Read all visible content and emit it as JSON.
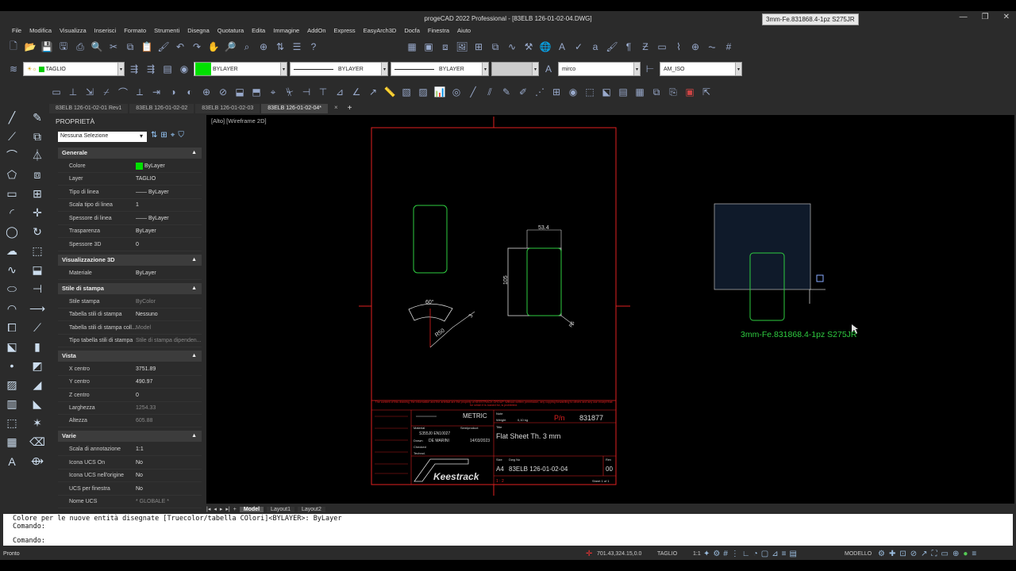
{
  "window": {
    "title": "progeCAD 2022 Professional - [83ELB 126-01-02-04.DWG]",
    "tooltip": "3mm-Fe.831868.4-1pz S275JR"
  },
  "menu": [
    "File",
    "Modifica",
    "Visualizza",
    "Inserisci",
    "Formato",
    "Strumenti",
    "Disegna",
    "Quotatura",
    "Edita",
    "Immagine",
    "AddOn",
    "Express",
    "EasyArch3D",
    "Docfa",
    "Finestra",
    "Aiuto"
  ],
  "toolbar": {
    "layer_combo": "TAGLIO",
    "color_combo": "BYLAYER",
    "linetype_combo": "BYLAYER",
    "lineweight_combo": "BYLAYER",
    "textstyle_combo": "mirco",
    "dimstyle_combo": "AM_ISO",
    "color_accent": "#00e000"
  },
  "doc_tabs": [
    "83ELB 126-01-02-01 Rev1",
    "83ELB 126-01-02-02",
    "83ELB 126-01-02-03",
    "83ELB 126-01-02-04*"
  ],
  "props": {
    "title": "PROPRIETÀ",
    "selection": "Nessuna Selezione",
    "generale": {
      "label": "Generale",
      "rows": [
        [
          "Colore",
          "ByLayer"
        ],
        [
          "Layer",
          "TAGLIO"
        ],
        [
          "Tipo di linea",
          "—— ByLayer"
        ],
        [
          "Scala tipo di linea",
          "1"
        ],
        [
          "Spessore di linea",
          "—— ByLayer"
        ],
        [
          "Trasparenza",
          "ByLayer"
        ],
        [
          "Spessore 3D",
          "0"
        ]
      ]
    },
    "vis3d": {
      "label": "Visualizzazione 3D",
      "rows": [
        [
          "Materiale",
          "ByLayer"
        ]
      ]
    },
    "stampa": {
      "label": "Stile di stampa",
      "rows": [
        [
          "Stile stampa",
          "ByColor"
        ],
        [
          "Tabella stili di stampa",
          "Nessuno"
        ],
        [
          "Tabella stili di stampa coll...",
          "Model"
        ],
        [
          "Tipo tabella stili di stampa",
          "Stile di stampa dipenden..."
        ]
      ]
    },
    "vista": {
      "label": "Vista",
      "rows": [
        [
          "X centro",
          "3751.89"
        ],
        [
          "Y centro",
          "490.97"
        ],
        [
          "Z centro",
          "0"
        ],
        [
          "Larghezza",
          "1254.33"
        ],
        [
          "Altezza",
          "605.88"
        ]
      ]
    },
    "varie": {
      "label": "Varie",
      "rows": [
        [
          "Scala di annotazione",
          "1:1"
        ],
        [
          "Icona UCS On",
          "No"
        ],
        [
          "Icona UCS nell'origine",
          "No"
        ],
        [
          "UCS per finestra",
          "No"
        ],
        [
          "Nome UCS",
          "* GLOBALE *"
        ]
      ]
    }
  },
  "canvas": {
    "view_label": "[Alto] [Wireframe 2D]",
    "dims": {
      "width": "53.4",
      "height": "105",
      "angle": "60°",
      "radius": "R50",
      "thk": "3",
      "r5": "R5"
    },
    "notice": "The content of this drawing, the information and the artefact are the property of KEESTRACK GROUP. Without written permission, any copying forwarding to others and any use except that for which it is loaned for, is prohibited.",
    "title_block": {
      "metric": "METRIC",
      "pn_label": "P/n",
      "pn": "831877",
      "material_label": "Material",
      "material": "S355J0 EN10027",
      "drawn_label": "Drawn",
      "drawn": "DE MARINI",
      "date": "14/03/2023",
      "title_label": "Title",
      "title": "Flat Sheet Th. 3 mm",
      "weight": "0,10 kg",
      "size_label": "Size",
      "size": "A4",
      "dwg_label": "Dwg No",
      "dwg": "83ELB 126-01-02-04",
      "rev_label": "Rev",
      "rev": "00",
      "sheet": "Sheet 1 of 1",
      "scale": "1 : 2",
      "brand": "Keestrack",
      "semi": "Semiproduct",
      "checked": "Checked",
      "technol": "Technol."
    },
    "part_label": "3mm-Fe.831868.4-1pz S275JR"
  },
  "layout_tabs": [
    "Model",
    "Layout1",
    "Layout2"
  ],
  "command": {
    "line1": "Colore per le nuove entità disegnate [Truecolor/tabella COlori]<BYLAYER>: ByLayer",
    "line2": "Comando:",
    "line3": "Comando:"
  },
  "status": {
    "left": "Pronto",
    "coords": "701.43,324.15,0.0",
    "layer": "TAGLIO",
    "scale": "1:1",
    "model": "MODELLO"
  }
}
